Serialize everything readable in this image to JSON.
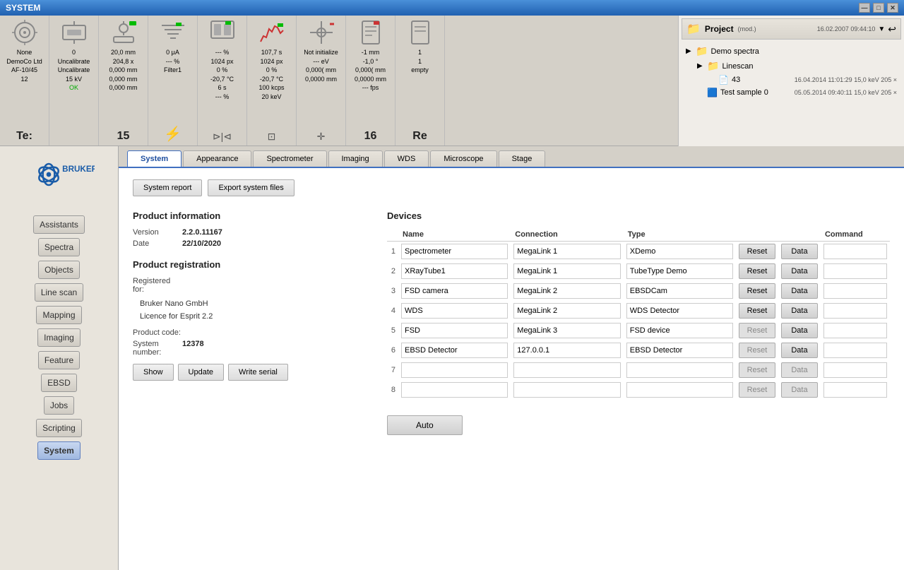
{
  "titleBar": {
    "title": "SYSTEM",
    "minBtn": "—",
    "maxBtn": "□",
    "closeBtn": "✕"
  },
  "toolbar": {
    "items": [
      {
        "id": "beam",
        "icon": "⚙",
        "lines": [
          "None",
          "DemoCo Ltd",
          "AF-10/45",
          "12"
        ],
        "label": "Te:"
      },
      {
        "id": "stage",
        "icon": "⊞",
        "lines": [
          "0",
          "Uncalibrate",
          "Uncalibrate",
          "15 kV",
          "OK"
        ],
        "label": ""
      },
      {
        "id": "current",
        "icon": "◷",
        "lines": [
          "20,0 mm",
          "204,8 x",
          "0,000 mm",
          "0,000 mm",
          "0,000 mm"
        ],
        "label": "15"
      },
      {
        "id": "filter",
        "icon": "≋",
        "lines": [
          "0 μA",
          "---  %",
          "Filter1"
        ],
        "label": "⚡"
      },
      {
        "id": "detector",
        "icon": "▦",
        "lines": [
          "--- %",
          "1024 px",
          "0 %",
          "-20,7 °C",
          "6 s",
          "--- %"
        ],
        "label": "⊳"
      },
      {
        "id": "spectrum",
        "icon": "▐▌",
        "lines": [
          "107,7 s",
          "1024 px",
          "0 %",
          "-20,7 °C",
          "100 kcps",
          "20 keV"
        ],
        "label": "⊡"
      },
      {
        "id": "wds",
        "icon": "⛉",
        "lines": [
          "Not initialize",
          "---  eV",
          "0,000( mm",
          "0,0000 mm"
        ],
        "label": "✛"
      },
      {
        "id": "report",
        "icon": "📄",
        "lines": [
          "-1 mm",
          "-1,0 °",
          "0,000( mm",
          "0,0000 mm",
          "--- fps"
        ],
        "label": "16"
      },
      {
        "id": "report2",
        "icon": "📋",
        "lines": [
          "1",
          "1",
          "empty"
        ],
        "label": "Re"
      }
    ]
  },
  "projectPanel": {
    "title": "Project",
    "mod": "(mod.)",
    "datetime": "16.02.2007 09:44:10",
    "treeItems": [
      {
        "indent": 0,
        "type": "folder",
        "label": "Demo spectra",
        "date": "",
        "kev": ""
      },
      {
        "indent": 1,
        "type": "folder",
        "label": "Linescan",
        "date": "",
        "kev": ""
      },
      {
        "indent": 2,
        "type": "file",
        "label": "43",
        "date": "16.04.2014  11:01:29",
        "kev": "15,0 keV  205 ×"
      },
      {
        "indent": 1,
        "type": "file-color",
        "label": "Test sample 0",
        "date": "05.05.2014  09:40:11",
        "kev": "15,0 keV  205 ×"
      }
    ]
  },
  "tabs": [
    {
      "id": "system",
      "label": "System",
      "active": true
    },
    {
      "id": "appearance",
      "label": "Appearance",
      "active": false
    },
    {
      "id": "spectrometer",
      "label": "Spectrometer",
      "active": false
    },
    {
      "id": "imaging",
      "label": "Imaging",
      "active": false
    },
    {
      "id": "wds",
      "label": "WDS",
      "active": false
    },
    {
      "id": "microscope",
      "label": "Microscope",
      "active": false
    },
    {
      "id": "stage",
      "label": "Stage",
      "active": false
    }
  ],
  "content": {
    "actionButtons": [
      {
        "id": "system-report",
        "label": "System report"
      },
      {
        "id": "export-system-files",
        "label": "Export system files"
      }
    ],
    "productInfo": {
      "sectionTitle": "Product information",
      "versionLabel": "Version",
      "versionValue": "2.2.0.11167",
      "dateLabel": "Date",
      "dateValue": "22/10/2020"
    },
    "productRegistration": {
      "sectionTitle": "Product registration",
      "registeredForLabel": "Registered for:",
      "company": "Bruker Nano GmbH",
      "license": "Licence for Esprit 2.2",
      "productCodeLabel": "Product code:",
      "systemNumberLabel": "System number:",
      "systemNumberValue": "12378",
      "buttons": [
        {
          "id": "show-btn",
          "label": "Show"
        },
        {
          "id": "update-btn",
          "label": "Update"
        },
        {
          "id": "write-serial-btn",
          "label": "Write serial"
        }
      ]
    },
    "devices": {
      "sectionTitle": "Devices",
      "columns": [
        "Name",
        "Connection",
        "Type",
        "",
        "",
        "Command"
      ],
      "rows": [
        {
          "num": "1",
          "name": "Spectrometer",
          "connection": "MegaLink 1",
          "type": "XDemo",
          "resetEnabled": true,
          "dataEnabled": true,
          "command": ""
        },
        {
          "num": "2",
          "name": "XRayTube1",
          "connection": "MegaLink 1",
          "type": "TubeType Demo",
          "resetEnabled": true,
          "dataEnabled": true,
          "command": ""
        },
        {
          "num": "3",
          "name": "FSD camera",
          "connection": "MegaLink 2",
          "type": "EBSDCam",
          "resetEnabled": true,
          "dataEnabled": true,
          "command": ""
        },
        {
          "num": "4",
          "name": "WDS",
          "connection": "MegaLink 2",
          "type": "WDS Detector",
          "resetEnabled": true,
          "dataEnabled": true,
          "command": ""
        },
        {
          "num": "5",
          "name": "FSD",
          "connection": "MegaLink 3",
          "type": "FSD device",
          "resetEnabled": false,
          "dataEnabled": true,
          "command": ""
        },
        {
          "num": "6",
          "name": "EBSD Detector",
          "connection": "127.0.0.1",
          "type": "EBSD Detector",
          "resetEnabled": false,
          "dataEnabled": true,
          "command": ""
        },
        {
          "num": "7",
          "name": "",
          "connection": "",
          "type": "",
          "resetEnabled": false,
          "dataEnabled": false,
          "command": ""
        },
        {
          "num": "8",
          "name": "",
          "connection": "",
          "type": "",
          "resetEnabled": false,
          "dataEnabled": false,
          "command": ""
        }
      ],
      "autoButton": "Auto"
    }
  },
  "sidebar": {
    "buttons": [
      {
        "id": "assistants",
        "label": "Assistants",
        "active": false
      },
      {
        "id": "spectra",
        "label": "Spectra",
        "active": false
      },
      {
        "id": "objects",
        "label": "Objects",
        "active": false
      },
      {
        "id": "line-scan",
        "label": "Line scan",
        "active": false
      },
      {
        "id": "mapping",
        "label": "Mapping",
        "active": false
      },
      {
        "id": "imaging",
        "label": "Imaging",
        "active": false
      },
      {
        "id": "feature",
        "label": "Feature",
        "active": false
      },
      {
        "id": "ebsd",
        "label": "EBSD",
        "active": false
      },
      {
        "id": "jobs",
        "label": "Jobs",
        "active": false
      },
      {
        "id": "scripting",
        "label": "Scripting",
        "active": false
      },
      {
        "id": "system",
        "label": "System",
        "active": true
      }
    ]
  }
}
